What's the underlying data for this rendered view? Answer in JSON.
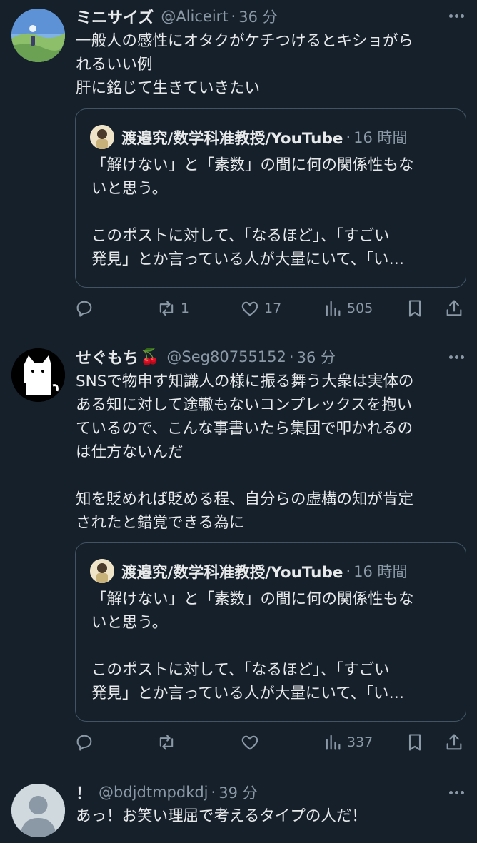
{
  "colors": {
    "background": "#15202b",
    "text": "#e7e9ea",
    "muted": "#8b98a5",
    "border": "#38444d"
  },
  "tweets": [
    {
      "name": "ミニサイズ",
      "handle": "@Aliceirt",
      "dot": "·",
      "time": "36 分",
      "text": "一般人の感性にオタクがケチつけるとキショがら\nれるいい例\n肝に銘じて生きていきたい",
      "quote": {
        "name": "渡邉究/数学科准教授/YouTube",
        "dot": "·",
        "time": "16 時間",
        "text": "「解けない」と「素数」の間に何の関係性もな\nいと思う。\n\nこのポストに対して、「なるほど」、「すごい\n発見」とか言っている人が大量にいて、「い…"
      },
      "stats": {
        "replies": "",
        "reposts": "1",
        "likes": "17",
        "views": "505"
      }
    },
    {
      "name": "せぐもち",
      "name_emoji": "🍒",
      "handle": "@Seg80755152",
      "dot": "·",
      "time": "36 分",
      "text": "SNSで物申す知識人の様に振る舞う大衆は実体の\nある知に対して途轍もないコンプレックスを抱い\nているので、こんな事書いたら集団で叩かれるの\nは仕方ないんだ\n\n知を貶めれば貶める程、自分らの虚構の知が肯定\nされたと錯覚できる為に",
      "quote": {
        "name": "渡邉究/数学科准教授/YouTube",
        "dot": "·",
        "time": "16 時間",
        "text": "「解けない」と「素数」の間に何の関係性もな\nいと思う。\n\nこのポストに対して、「なるほど」、「すごい\n発見」とか言っている人が大量にいて、「い…"
      },
      "stats": {
        "replies": "",
        "reposts": "",
        "likes": "",
        "views": "337"
      }
    },
    {
      "name": "！",
      "handle": "@bdjdtmpdkdj",
      "dot": "·",
      "time": "39 分",
      "text": "あっ！お笑い理屈で考えるタイプの人だ！"
    }
  ]
}
